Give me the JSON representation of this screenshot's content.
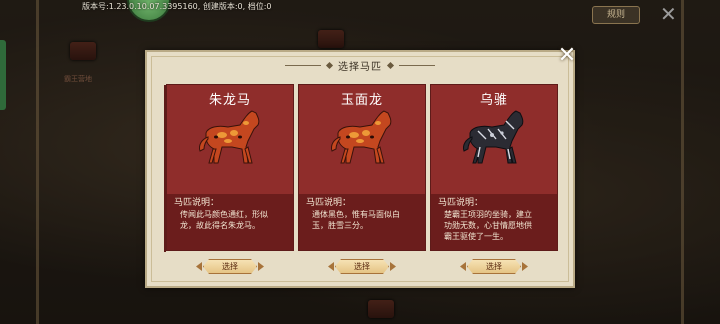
{
  "status": {
    "version_text": "版本号:1.23.0.10.07.3395160, 创建版本:0, 档位:0"
  },
  "background": {
    "top_right_button_label": "规则",
    "map_labels": [
      "霸王营地"
    ]
  },
  "modal": {
    "title": "选择马匹",
    "cards": [
      {
        "name": "朱龙马",
        "desc_label": "马匹说明：",
        "desc_lines": [
          "传闻此马颜色通红，形似",
          "龙，故此得名朱龙马。"
        ],
        "horse_icon": "red-horse-icon",
        "select_label": "选择"
      },
      {
        "name": "玉面龙",
        "desc_label": "马匹说明：",
        "desc_lines": [
          "通体黑色，惟有马面似白",
          "玉，胜雪三分。"
        ],
        "horse_icon": "red-horse-icon",
        "select_label": "选择"
      },
      {
        "name": "乌骓",
        "desc_label": "马匹说明：",
        "desc_lines": [
          "楚霸王项羽的坐骑，建立",
          "功勋无数，心甘情愿地供",
          "霸王驱使了一生。"
        ],
        "horse_icon": "black-horse-icon",
        "select_label": "选择"
      }
    ]
  },
  "colors": {
    "card_bg": "#8f2d2b",
    "desc_bg": "#6b1d1c",
    "modal_bg": "#e6ddc6",
    "button_gold": "#e5c485"
  }
}
